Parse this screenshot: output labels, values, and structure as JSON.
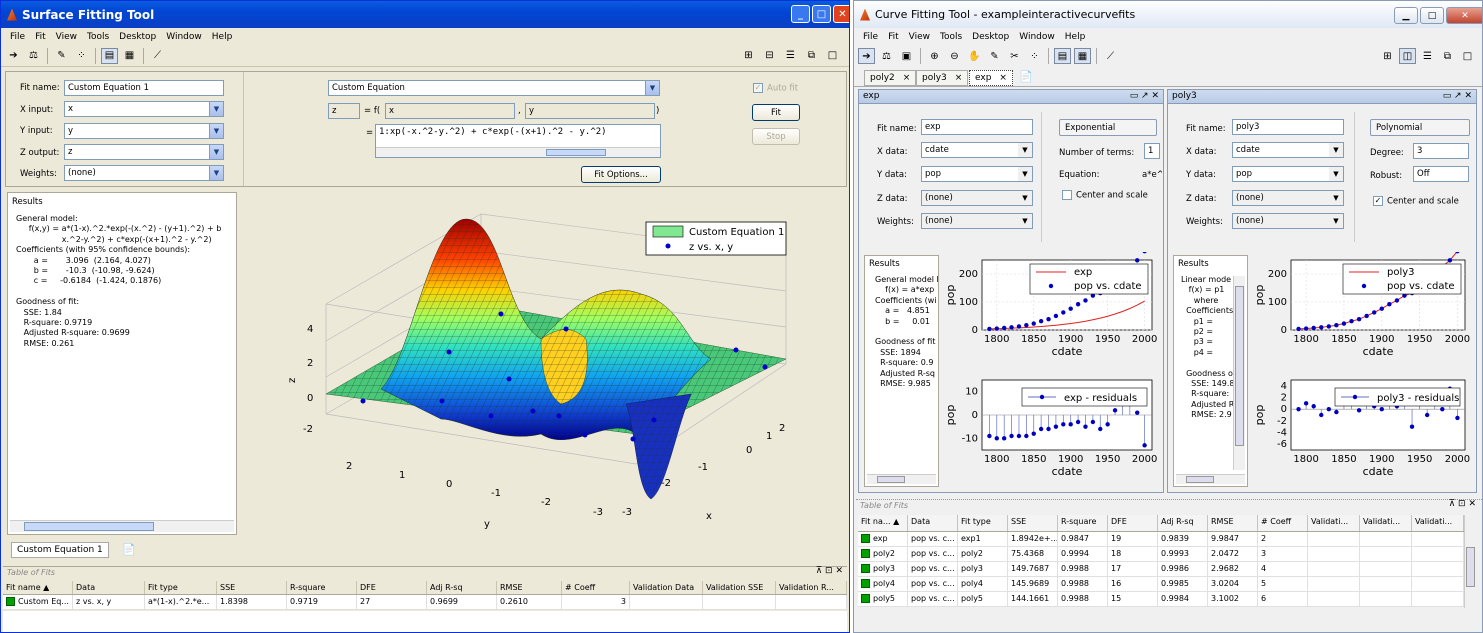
{
  "w1": {
    "title": "Surface Fitting Tool",
    "menu": [
      "File",
      "Fit",
      "View",
      "Tools",
      "Desktop",
      "Window",
      "Help"
    ],
    "fit_name_label": "Fit name:",
    "fit_name": "Custom Equation 1",
    "x_label": "X input:",
    "x_val": "x",
    "y_label": "Y input:",
    "y_val": "y",
    "z_label": "Z output:",
    "z_val": "z",
    "w_label": "Weights:",
    "w_val": "(none)",
    "eq_type": "Custom Equation",
    "eq_z": "z",
    "eq_eq": "= f(",
    "eq_x": "x",
    "eq_comma": ",",
    "eq_y": "y",
    "eq_close": ")",
    "eq_eq2": "=",
    "eq_text": "1:xp(-x.^2-y.^2) + c*exp(-(x+1).^2 - y.^2)",
    "autofit": "Auto fit",
    "fit_btn": "Fit",
    "stop_btn": "Stop",
    "fit_options": "Fit Options...",
    "results_title": "Results",
    "results_text": "General model:\n     f(x,y) = a*(1-x).^2.*exp(-(x.^2) - (y+1).^2) + b\n                  x.^2-y.^2) + c*exp(-(x+1).^2 - y.^2)\nCoefficients (with 95% confidence bounds):\n       a =       3.096  (2.164, 4.027)\n       b =       -10.3  (-10.98, -9.624)\n       c =     -0.6184  (-1.424, 0.1876)\n\nGoodness of fit:\n   SSE: 1.84\n   R-square: 0.9719\n   Adjusted R-square: 0.9699\n   RMSE: 0.261",
    "legend1": "Custom Equation 1",
    "legend2": "z vs. x, y",
    "z_ticks": [
      "4",
      "2",
      "0",
      "-2"
    ],
    "z_axis": "z",
    "y_ticks": [
      "2",
      "1",
      "0",
      "-1",
      "-2",
      "-3"
    ],
    "y_axis": "y",
    "x_ticks": [
      "-3",
      "-2",
      "-1",
      "0",
      "1",
      "2"
    ],
    "x_axis": "x",
    "doc_tab": "Custom Equation 1",
    "tof_title": "Table of Fits",
    "tof_cols": [
      "Fit name ▲",
      "Data",
      "Fit type",
      "SSE",
      "R-square",
      "DFE",
      "Adj R-sq",
      "RMSE",
      "# Coeff",
      "Validation Data",
      "Validation SSE",
      "Validation R..."
    ],
    "tof_row": [
      "Custom Eq...",
      "z vs. x, y",
      "a*(1-x).^2.*e...",
      "1.8398",
      "0.9719",
      "27",
      "0.9699",
      "0.2610",
      "3",
      "",
      "",
      ""
    ]
  },
  "w2": {
    "title": "Curve Fitting Tool - exampleinteractivecurvefits",
    "menu": [
      "File",
      "Fit",
      "View",
      "Tools",
      "Desktop",
      "Window",
      "Help"
    ],
    "tabs": [
      "poly2",
      "poly3",
      "exp"
    ],
    "p1": {
      "hdr": "exp",
      "fit_name_label": "Fit name:",
      "fit_name": "exp",
      "x_label": "X data:",
      "x_val": "cdate",
      "y_label": "Y data:",
      "y_val": "pop",
      "z_label": "Z data:",
      "z_val": "(none)",
      "w_label": "Weights:",
      "w_val": "(none)",
      "type": "Exponential",
      "terms_label": "Number of terms:",
      "terms": "1",
      "eq_label": "Equation:",
      "eq": "a*e^",
      "center": "Center and scale",
      "results_title": "Results",
      "results_text": "General model E\n    f(x) = a*exp\nCoefficients (wi\n    a =   4.851\n    b =     0.01\n\nGoodness of fit\n  SSE: 1894\n  R-square: 0.9\n  Adjusted R-sq\n  RMSE: 9.985",
      "leg1": "exp",
      "leg2": "pop vs. cdate",
      "res_leg": "exp - residuals",
      "xlabel": "cdate",
      "ylabel": "pop",
      "top_yt": [
        "200",
        "100",
        "0"
      ],
      "bot_yt": [
        "10",
        "0",
        "-10"
      ],
      "xt": [
        "1800",
        "1850",
        "1900",
        "1950",
        "2000"
      ]
    },
    "p2": {
      "hdr": "poly3",
      "fit_name_label": "Fit name:",
      "fit_name": "poly3",
      "x_label": "X data:",
      "x_val": "cdate",
      "y_label": "Y data:",
      "y_val": "pop",
      "z_label": "Z data:",
      "z_val": "(none)",
      "w_label": "Weights:",
      "w_val": "(none)",
      "type": "Polynomial",
      "deg_label": "Degree:",
      "deg": "3",
      "rob_label": "Robust:",
      "rob": "Off",
      "center": "Center and scale",
      "results_title": "Results",
      "results_text": "Linear mode\n   f(x) = p1\n     where \n  Coefficients\n     p1 =\n     p2 =\n     p3 =\n     p4 =\n\n  Goodness o\n    SSE: 149.8\n    R-square:\n    Adjusted R\n    RMSE: 2.9",
      "leg1": "poly3",
      "leg2": "pop vs. cdate",
      "res_leg": "poly3 - residuals",
      "xlabel": "cdate",
      "ylabel": "pop",
      "top_yt": [
        "200",
        "100",
        "0"
      ],
      "bot_yt": [
        "4",
        "2",
        "0",
        "-2",
        "-4",
        "-6"
      ],
      "xt": [
        "1800",
        "1850",
        "1900",
        "1950",
        "2000"
      ]
    },
    "tof_title": "Table of Fits",
    "tof_cols": [
      "Fit na... ▲",
      "Data",
      "Fit type",
      "SSE",
      "R-square",
      "DFE",
      "Adj R-sq",
      "RMSE",
      "# Coeff",
      "Validati...",
      "Validati...",
      "Validati..."
    ],
    "tof_rows": [
      [
        "exp",
        "pop vs. c...",
        "exp1",
        "1.8942e+...",
        "0.9847",
        "19",
        "0.9839",
        "9.9847",
        "2",
        "",
        "",
        ""
      ],
      [
        "poly2",
        "pop vs. c...",
        "poly2",
        "75.4368",
        "0.9994",
        "18",
        "0.9993",
        "2.0472",
        "3",
        "",
        "",
        ""
      ],
      [
        "poly3",
        "pop vs. c...",
        "poly3",
        "149.7687",
        "0.9988",
        "17",
        "0.9986",
        "2.9682",
        "4",
        "",
        "",
        ""
      ],
      [
        "poly4",
        "pop vs. c...",
        "poly4",
        "145.9689",
        "0.9988",
        "16",
        "0.9985",
        "3.0204",
        "5",
        "",
        "",
        ""
      ],
      [
        "poly5",
        "pop vs. c...",
        "poly5",
        "144.1661",
        "0.9988",
        "15",
        "0.9984",
        "3.1002",
        "6",
        "",
        "",
        ""
      ]
    ]
  }
}
